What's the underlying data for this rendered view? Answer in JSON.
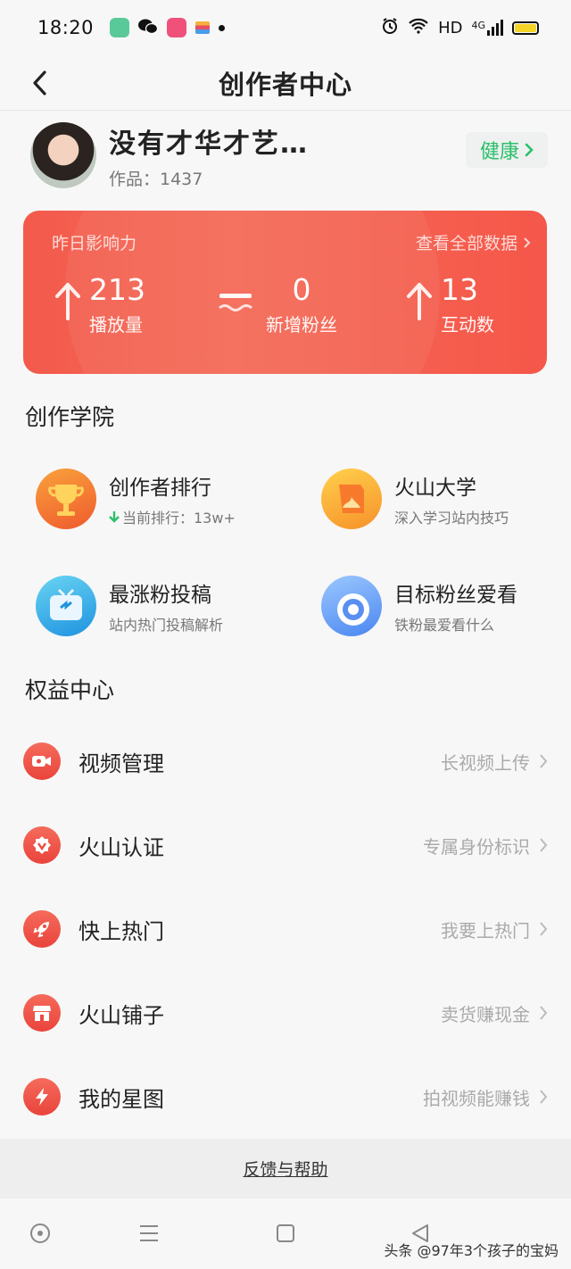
{
  "status_bar": {
    "time": "18:20",
    "network": "HD",
    "cell": "4G",
    "app_icons": [
      "green-app-icon",
      "wechat-icon",
      "video-app-icon",
      "stripe-app-icon"
    ]
  },
  "nav": {
    "title": "创作者中心"
  },
  "profile": {
    "name": "没有才华才艺…",
    "works_label": "作品：1437",
    "health_label": "健康",
    "accent_color": "#2cbf6c"
  },
  "stats": {
    "header_label": "昨日影响力",
    "view_all_label": "查看全部数据",
    "items": [
      {
        "value": "213",
        "label": "播放量",
        "trend": "up"
      },
      {
        "value": "0",
        "label": "新增粉丝",
        "trend": "flat"
      },
      {
        "value": "13",
        "label": "互动数",
        "trend": "up"
      }
    ],
    "card_color": "#f35a4b"
  },
  "academy": {
    "title": "创作学院",
    "items": [
      {
        "title": "创作者排行",
        "subtitle": "当前排行：13w+",
        "icon": "trophy-icon"
      },
      {
        "title": "火山大学",
        "subtitle": "深入学习站内技巧",
        "icon": "book-icon"
      },
      {
        "title": "最涨粉投稿",
        "subtitle": "站内热门投稿解析",
        "icon": "tv-icon"
      },
      {
        "title": "目标粉丝爱看",
        "subtitle": "铁粉最爱看什么",
        "icon": "target-icon"
      }
    ]
  },
  "rights": {
    "title": "权益中心",
    "items": [
      {
        "label": "视频管理",
        "hint": "长视频上传",
        "icon": "video-camera-icon"
      },
      {
        "label": "火山认证",
        "hint": "专属身份标识",
        "icon": "verified-badge-icon"
      },
      {
        "label": "快上热门",
        "hint": "我要上热门",
        "icon": "rocket-icon"
      },
      {
        "label": "火山铺子",
        "hint": "卖货赚现金",
        "icon": "shop-icon"
      },
      {
        "label": "我的星图",
        "hint": "拍视频能赚钱",
        "icon": "lightning-icon"
      }
    ]
  },
  "footer": {
    "help_label": "反馈与帮助"
  },
  "watermark": "头条 @97年3个孩子的宝妈"
}
